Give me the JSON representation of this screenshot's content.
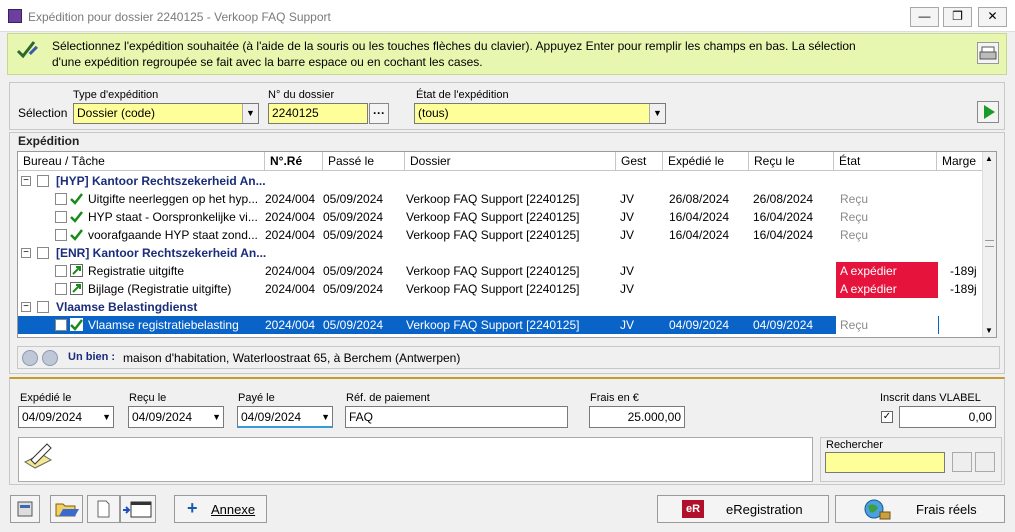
{
  "window": {
    "title": "Expédition pour dossier 2240125 - Verkoop FAQ Support",
    "minimize": "—",
    "restore": "❐",
    "close": "✕"
  },
  "info": {
    "line1": "Sélectionnez l'expédition souhaitée (à l'aide de la souris ou les touches flèches du clavier). Appuyez Enter pour remplir les champs en bas. La sélection",
    "line2": "d'une expédition regroupée se fait avec la barre espace ou en cochant les cases."
  },
  "selection": {
    "label": "Sélection",
    "type_label": "Type d'expédition",
    "type_value": "Dossier (code)",
    "dossier_label": "N° du dossier",
    "dossier_value": "2240125",
    "dossier_btn": "···",
    "etat_label": "État de l'expédition",
    "etat_value": "(tous)"
  },
  "list": {
    "group_label": "Expédition",
    "columns": [
      "Bureau / Tâche",
      "N°.Ré",
      "Passé le",
      "Dossier",
      "Gest",
      "Expédié le",
      "Reçu le",
      "État",
      "Marge"
    ],
    "groups": [
      {
        "name": "[HYP] Kantoor Rechtszekerheid An...",
        "rows": [
          {
            "task": "Uitgifte neerleggen op het hyp...",
            "nre": "2024/004",
            "passe": "05/09/2024",
            "dossier": "Verkoop FAQ Support [2240125]",
            "gest": "JV",
            "expedie": "26/08/2024",
            "recu": "26/08/2024",
            "etat": "Reçu",
            "marge": "",
            "icon": "check-icon"
          },
          {
            "task": "HYP staat - Oorspronkelijke vi...",
            "nre": "2024/004",
            "passe": "05/09/2024",
            "dossier": "Verkoop FAQ Support [2240125]",
            "gest": "JV",
            "expedie": "16/04/2024",
            "recu": "16/04/2024",
            "etat": "Reçu",
            "marge": "",
            "icon": "check-icon"
          },
          {
            "task": "voorafgaande HYP staat zond...",
            "nre": "2024/004",
            "passe": "05/09/2024",
            "dossier": "Verkoop FAQ Support [2240125]",
            "gest": "JV",
            "expedie": "16/04/2024",
            "recu": "16/04/2024",
            "etat": "Reçu",
            "marge": "",
            "icon": "check-icon"
          }
        ]
      },
      {
        "name": "[ENR] Kantoor Rechtszekerheid An...",
        "rows": [
          {
            "task": "Registratie uitgifte",
            "nre": "2024/004",
            "passe": "05/09/2024",
            "dossier": "Verkoop FAQ Support [2240125]",
            "gest": "JV",
            "expedie": "",
            "recu": "",
            "etat": "A expédier",
            "marge": "-189j",
            "icon": "send-icon"
          },
          {
            "task": "Bijlage (Registratie uitgifte)",
            "nre": "2024/004",
            "passe": "05/09/2024",
            "dossier": "Verkoop FAQ Support [2240125]",
            "gest": "JV",
            "expedie": "",
            "recu": "",
            "etat": "A expédier",
            "marge": "-189j",
            "icon": "send-icon"
          }
        ]
      },
      {
        "name": "Vlaamse Belastingdienst",
        "rows": [
          {
            "task": "Vlaamse registratiebelasting",
            "nre": "2024/004",
            "passe": "05/09/2024",
            "dossier": "Verkoop FAQ Support [2240125]",
            "gest": "JV",
            "expedie": "04/09/2024",
            "recu": "04/09/2024",
            "etat": "Reçu",
            "marge": "",
            "icon": "check-icon",
            "selected": true
          }
        ]
      }
    ]
  },
  "bien": {
    "label": "Un bien :",
    "value": "maison d'habitation, Waterloostraat 65, à Berchem (Antwerpen)"
  },
  "detail": {
    "expedie_label": "Expédié le",
    "expedie_value": "04/09/2024",
    "recu_label": "Reçu le",
    "recu_value": "04/09/2024",
    "paye_label": "Payé le",
    "paye_value": "04/09/2024",
    "ref_label": "Réf. de paiement",
    "ref_value": "FAQ",
    "frais_label": "Frais en €",
    "frais_value": "25.000,00",
    "vlabel_label": "Inscrit dans VLABEL",
    "vlabel_value": "0,00",
    "vlabel_checked": "✓",
    "search_label": "Rechercher"
  },
  "toolbar": {
    "annexe_label": "Annexe",
    "eregistration_label": "eRegistration",
    "eregistration_badge": "eR",
    "frais_reels_label": "Frais réels"
  }
}
